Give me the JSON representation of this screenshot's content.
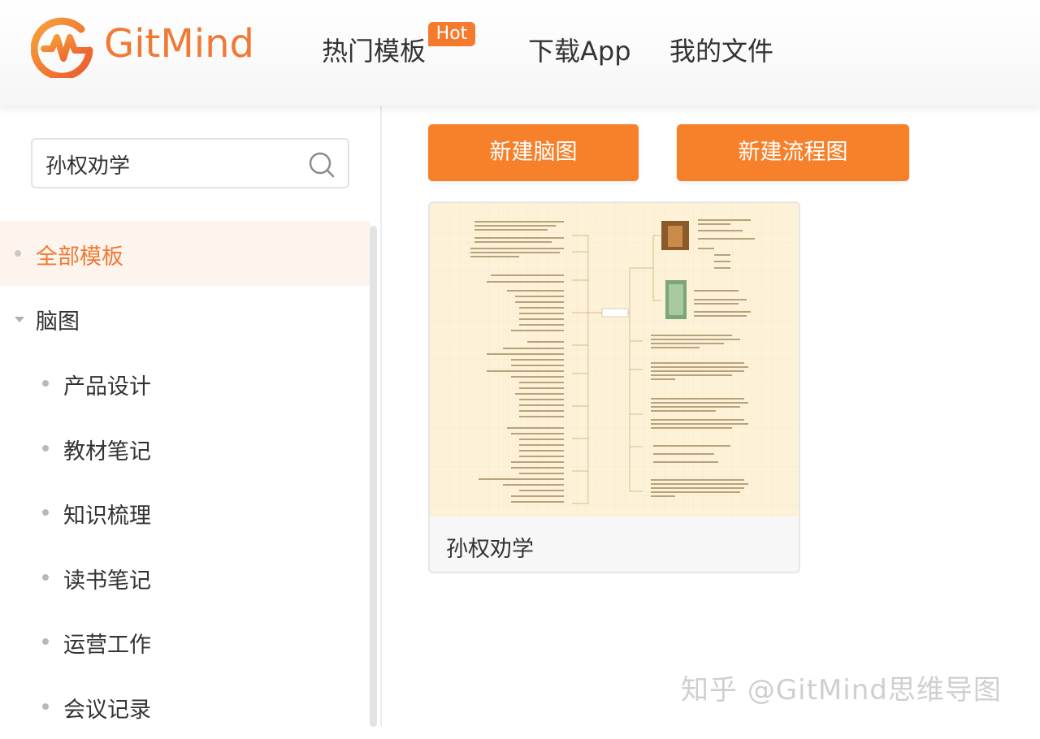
{
  "header": {
    "brand": "GitMind",
    "nav": {
      "hot_templates": "热门模板",
      "hot_badge": "Hot",
      "download_app": "下载App",
      "my_files": "我的文件"
    }
  },
  "search": {
    "value": "孙权劝学"
  },
  "sidebar": {
    "all_templates": "全部模板",
    "mindmap_group": "脑图",
    "items": [
      {
        "label": "产品设计"
      },
      {
        "label": "教材笔记"
      },
      {
        "label": "知识梳理"
      },
      {
        "label": "读书笔记"
      },
      {
        "label": "运营工作"
      },
      {
        "label": "会议记录"
      }
    ]
  },
  "actions": {
    "new_mindmap": "新建脑图",
    "new_flowchart": "新建流程图"
  },
  "results": [
    {
      "title": "孙权劝学"
    }
  ],
  "watermark": "知乎 @GitMind思维导图",
  "colors": {
    "accent": "#f7802b",
    "brand": "#f07a35",
    "active_bg": "#fdf4ee",
    "thumbnail_bg": "#fdf2d8"
  }
}
